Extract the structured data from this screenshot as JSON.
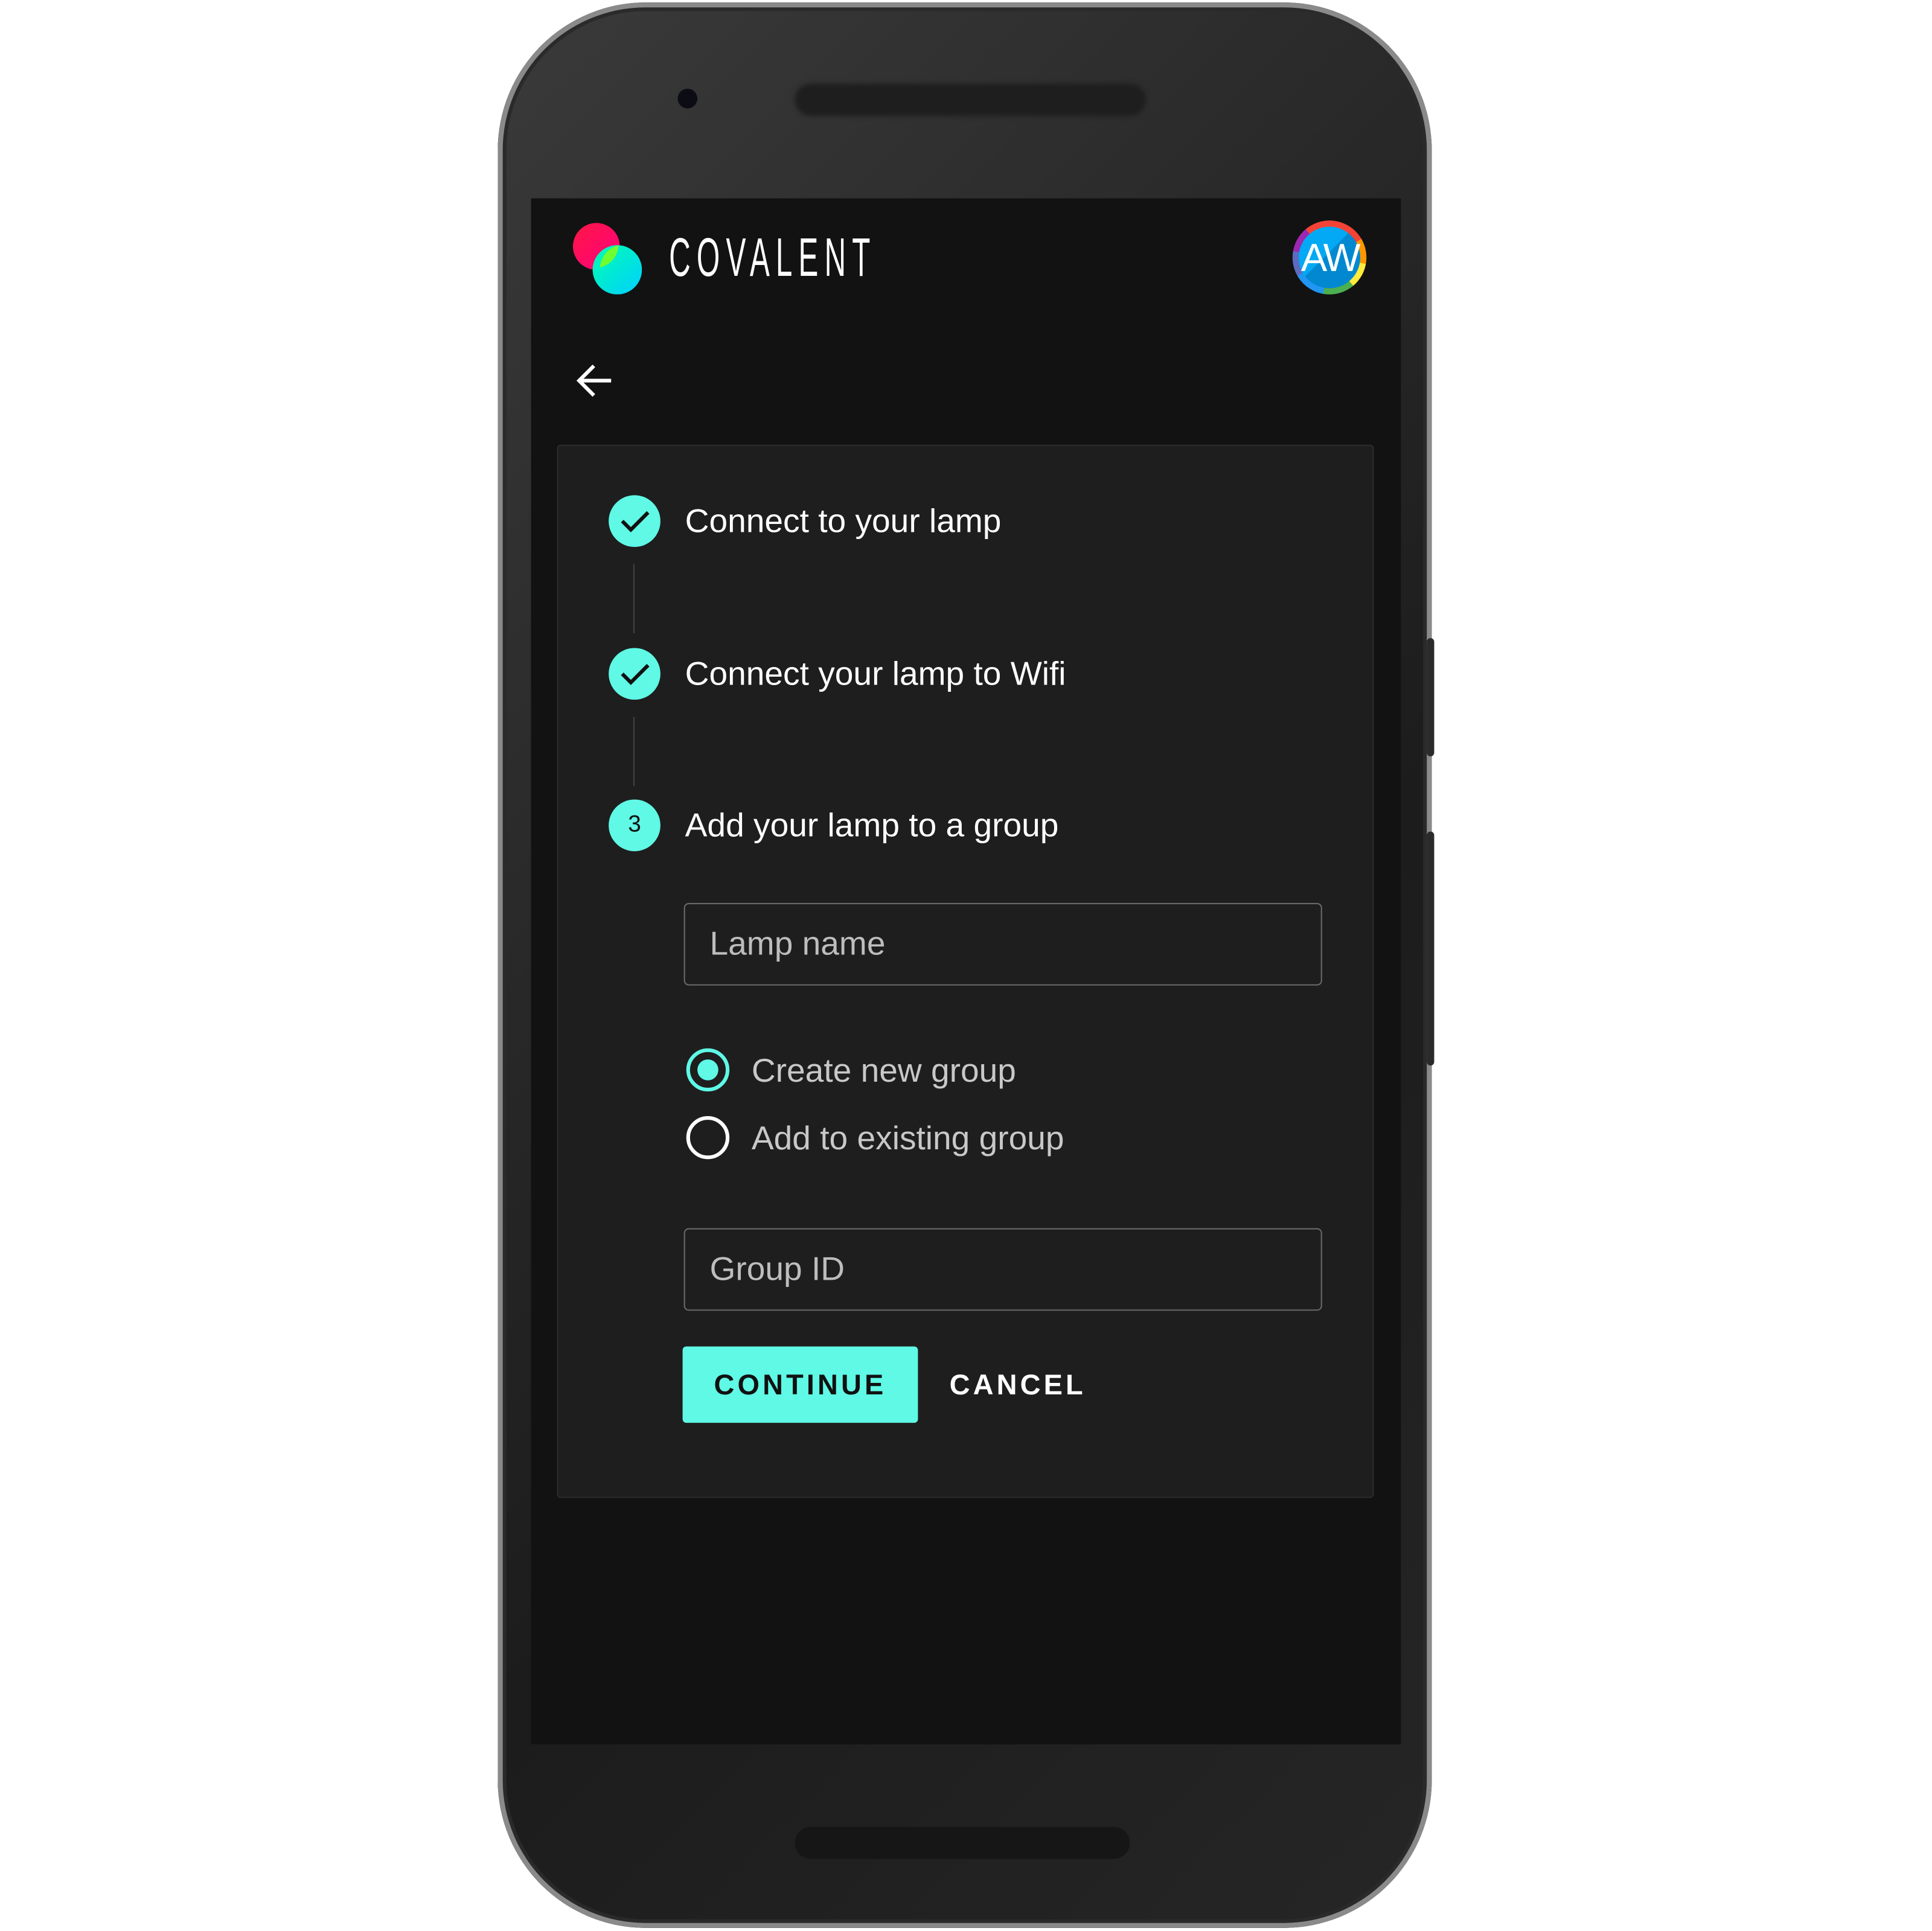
{
  "app": {
    "brand": "COVALENT",
    "avatar_initials": "AW"
  },
  "colors": {
    "accent": "#5ff9e6",
    "background": "#121212",
    "card": "#1e1e1e"
  },
  "stepper": {
    "steps": [
      {
        "index": "1",
        "label": "Connect to your lamp",
        "status": "complete"
      },
      {
        "index": "2",
        "label": "Connect your lamp to Wifi",
        "status": "complete"
      },
      {
        "index": "3",
        "label": "Add your lamp to a group",
        "status": "active"
      }
    ]
  },
  "form": {
    "lamp_name_placeholder": "Lamp name",
    "radio_options": [
      {
        "label": "Create new group",
        "selected": true
      },
      {
        "label": "Add to existing group",
        "selected": false
      }
    ],
    "group_id_placeholder": "Group ID",
    "continue_label": "CONTINUE",
    "cancel_label": "CANCEL"
  }
}
